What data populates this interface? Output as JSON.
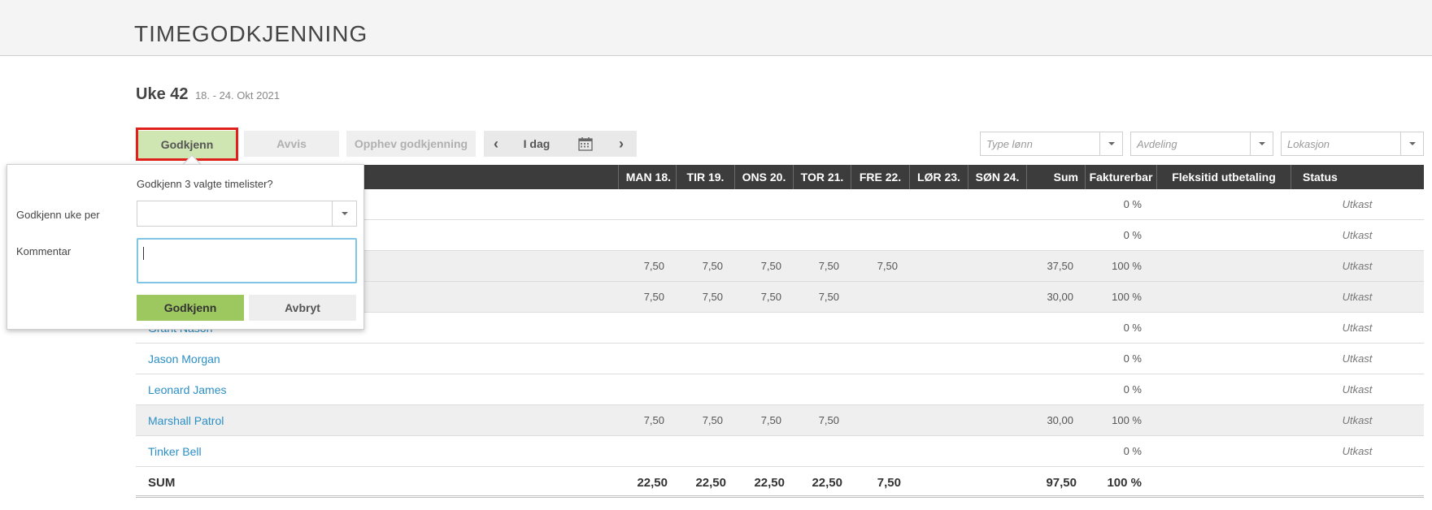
{
  "page": {
    "title": "TIMEGODKJENNING"
  },
  "week": {
    "title": "Uke 42",
    "range": "18. - 24. Okt 2021"
  },
  "toolbar": {
    "approve": "Godkjenn",
    "reject": "Avvis",
    "unapprove": "Opphev godkjenning",
    "prev": "‹",
    "today": "I dag",
    "next": "›"
  },
  "filters": {
    "lonn_placeholder": "Type lønn",
    "avdeling_placeholder": "Avdeling",
    "lokasjon_placeholder": "Lokasjon"
  },
  "table": {
    "headers": {
      "mon": "MAN 18.",
      "tue": "TIR 19.",
      "wed": "ONS 20.",
      "thu": "TOR 21.",
      "fri": "FRE 22.",
      "sat": "LØR 23.",
      "sun": "SØN 24.",
      "sum": "Sum",
      "billable": "Fakturerbar",
      "flex": "Fleksitid utbetaling",
      "status": "Status"
    },
    "rows": [
      {
        "name": "",
        "mon": "",
        "tue": "",
        "wed": "",
        "thu": "",
        "fri": "",
        "sum": "",
        "billable": "0 %",
        "status": "Utkast"
      },
      {
        "name": "",
        "mon": "",
        "tue": "",
        "wed": "",
        "thu": "",
        "fri": "",
        "sum": "",
        "billable": "0 %",
        "status": "Utkast"
      },
      {
        "name": "",
        "mon": "7,50",
        "tue": "7,50",
        "wed": "7,50",
        "thu": "7,50",
        "fri": "7,50",
        "sum": "37,50",
        "billable": "100 %",
        "status": "Utkast"
      },
      {
        "name": "",
        "mon": "7,50",
        "tue": "7,50",
        "wed": "7,50",
        "thu": "7,50",
        "fri": "",
        "sum": "30,00",
        "billable": "100 %",
        "status": "Utkast"
      },
      {
        "name": "Grant Nason",
        "mon": "",
        "tue": "",
        "wed": "",
        "thu": "",
        "fri": "",
        "sum": "",
        "billable": "0 %",
        "status": "Utkast"
      },
      {
        "name": "Jason Morgan",
        "mon": "",
        "tue": "",
        "wed": "",
        "thu": "",
        "fri": "",
        "sum": "",
        "billable": "0 %",
        "status": "Utkast"
      },
      {
        "name": "Leonard James",
        "mon": "",
        "tue": "",
        "wed": "",
        "thu": "",
        "fri": "",
        "sum": "",
        "billable": "0 %",
        "status": "Utkast"
      },
      {
        "name": "Marshall Patrol",
        "mon": "7,50",
        "tue": "7,50",
        "wed": "7,50",
        "thu": "7,50",
        "fri": "",
        "sum": "30,00",
        "billable": "100 %",
        "status": "Utkast"
      },
      {
        "name": "Tinker Bell",
        "mon": "",
        "tue": "",
        "wed": "",
        "thu": "",
        "fri": "",
        "sum": "",
        "billable": "0 %",
        "status": "Utkast"
      }
    ],
    "sum": {
      "label": "SUM",
      "mon": "22,50",
      "tue": "22,50",
      "wed": "22,50",
      "thu": "22,50",
      "fri": "7,50",
      "sum": "97,50",
      "billable": "100 %"
    }
  },
  "popup": {
    "question": "Godkjenn 3 valgte timelister?",
    "approve_per_label": "Godkjenn uke per",
    "approve_per_value": "",
    "comment_label": "Kommentar",
    "comment_value": "",
    "ok": "Godkjenn",
    "cancel": "Avbryt"
  }
}
